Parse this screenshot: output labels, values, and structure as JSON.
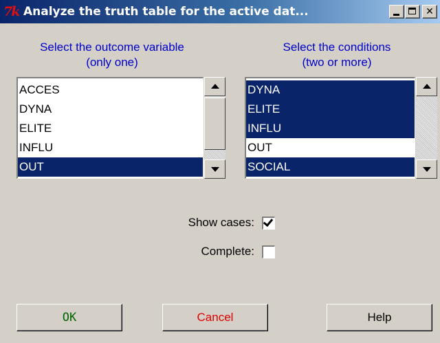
{
  "window": {
    "title": "Analyze the truth table for the active dat...",
    "logo_text": "7k",
    "titlebar_color": "#0a246a"
  },
  "outcome": {
    "heading_line1": "Select the outcome variable",
    "heading_line2": "(only one)",
    "items": [
      "ACCES",
      "DYNA",
      "ELITE",
      "INFLU",
      "OUT"
    ],
    "selected": [
      "OUT"
    ]
  },
  "conditions": {
    "heading_line1": "Select the conditions",
    "heading_line2": "(two or more)",
    "items": [
      "DYNA",
      "ELITE",
      "INFLU",
      "OUT",
      "SOCIAL"
    ],
    "selected": [
      "DYNA",
      "ELITE",
      "INFLU",
      "SOCIAL"
    ]
  },
  "options": {
    "show_cases_label": "Show cases:",
    "show_cases_checked": true,
    "complete_label": "Complete:",
    "complete_checked": false
  },
  "buttons": {
    "ok": "OK",
    "cancel": "Cancel",
    "help": "Help",
    "ok_color": "#006400",
    "cancel_color": "#e00000"
  },
  "icons": {
    "minimize": "minimize-icon",
    "maximize": "maximize-icon",
    "close": "close-icon",
    "scroll_up": "triangle-up-icon",
    "scroll_down": "triangle-down-icon",
    "check": "checkmark-icon"
  }
}
